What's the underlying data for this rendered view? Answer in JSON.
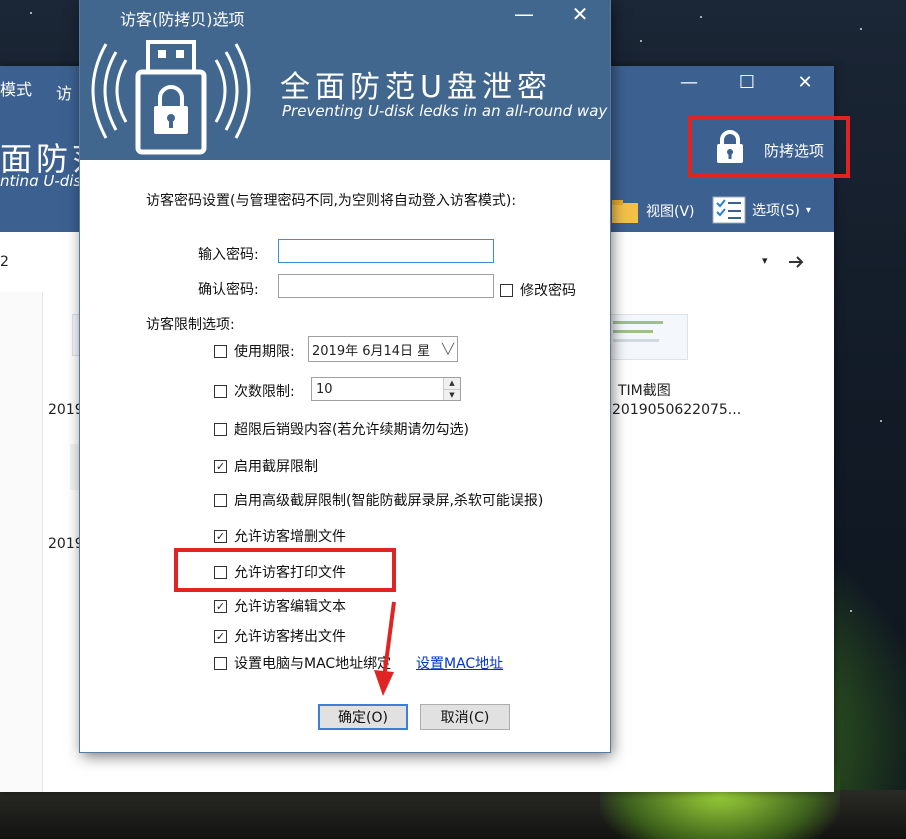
{
  "background_window": {
    "title_fragments": [
      "模式",
      "访"
    ],
    "header_big": "面防范",
    "header_sub": "nting U-disk",
    "guard_button_label": "防拷选项",
    "toolbar": {
      "view_label": "视图(V)",
      "options_label": "选项(S)",
      "options_caret": "▾"
    },
    "address_fragment": "2",
    "files": [
      {
        "name": "2019"
      },
      {
        "name": "2019"
      },
      {
        "name_line1": "TIM截图",
        "name_line2": "2019050622075..."
      }
    ],
    "controls": {
      "minimize": "—",
      "maximize": "☐",
      "close": "✕"
    }
  },
  "dialog": {
    "title": "访客(防拷贝)选项",
    "controls": {
      "minimize": "—",
      "close": "✕"
    },
    "banner_title": "全面防范U盘泄密",
    "banner_subtitle": "Preventing U-disk ledks in an all-round way",
    "password_section_label": "访客密码设置(与管理密码不同,为空则将自动登入访客模式):",
    "password_label": "输入密码:",
    "password_value": "",
    "confirm_label": "确认密码:",
    "confirm_value": "",
    "change_password": {
      "label": "修改密码",
      "checked": false
    },
    "limits_label": "访客限制选项:",
    "expiry": {
      "label": "使用期限:",
      "checked": false,
      "date_value": "2019年  6月14日  星"
    },
    "count_limit": {
      "label": "次数限制:",
      "checked": false,
      "value": "10"
    },
    "options": [
      {
        "label": "超限后销毁内容(若允许续期请勿勾选)",
        "checked": false
      },
      {
        "label": "启用截屏限制",
        "checked": true
      },
      {
        "label": "启用高级截屏限制(智能防截屏录屏,杀软可能误报)",
        "checked": false
      },
      {
        "label": "允许访客增删文件",
        "checked": true
      },
      {
        "label": "允许访客打印文件",
        "checked": false
      },
      {
        "label": "允许访客编辑文本",
        "checked": true
      },
      {
        "label": "允许访客拷出文件",
        "checked": true
      },
      {
        "label": "设置电脑与MAC地址绑定",
        "checked": false
      }
    ],
    "mac_link": "设置MAC地址",
    "ok_button": "确定(O)",
    "cancel_button": "取消(C)"
  },
  "colors": {
    "header_blue": "#41678f",
    "window_blue": "#3c6190",
    "highlight_red": "#e02424",
    "link_blue": "#0033cc"
  },
  "icons": [
    "usb-lock-icon",
    "lock-icon",
    "folder-icon",
    "checklist-icon",
    "arrow-right-icon",
    "annotation-arrow"
  ]
}
